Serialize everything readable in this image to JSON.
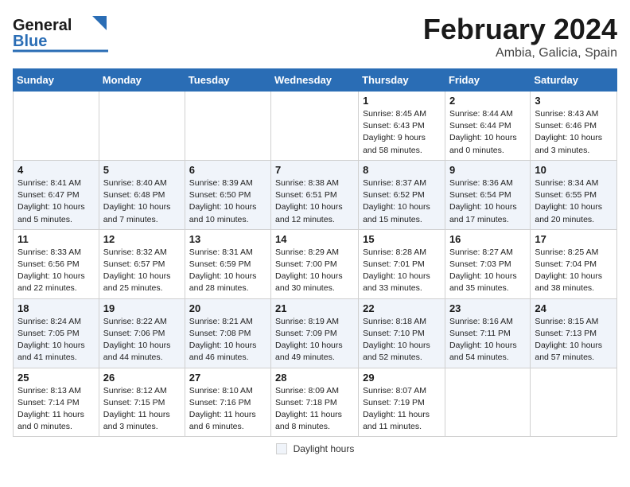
{
  "header": {
    "logo_general": "General",
    "logo_blue": "Blue",
    "month_title": "February 2024",
    "location": "Ambia, Galicia, Spain"
  },
  "calendar": {
    "days_of_week": [
      "Sunday",
      "Monday",
      "Tuesday",
      "Wednesday",
      "Thursday",
      "Friday",
      "Saturday"
    ],
    "weeks": [
      [
        {
          "day": "",
          "info": ""
        },
        {
          "day": "",
          "info": ""
        },
        {
          "day": "",
          "info": ""
        },
        {
          "day": "",
          "info": ""
        },
        {
          "day": "1",
          "info": "Sunrise: 8:45 AM\nSunset: 6:43 PM\nDaylight: 9 hours and 58 minutes."
        },
        {
          "day": "2",
          "info": "Sunrise: 8:44 AM\nSunset: 6:44 PM\nDaylight: 10 hours and 0 minutes."
        },
        {
          "day": "3",
          "info": "Sunrise: 8:43 AM\nSunset: 6:46 PM\nDaylight: 10 hours and 3 minutes."
        }
      ],
      [
        {
          "day": "4",
          "info": "Sunrise: 8:41 AM\nSunset: 6:47 PM\nDaylight: 10 hours and 5 minutes."
        },
        {
          "day": "5",
          "info": "Sunrise: 8:40 AM\nSunset: 6:48 PM\nDaylight: 10 hours and 7 minutes."
        },
        {
          "day": "6",
          "info": "Sunrise: 8:39 AM\nSunset: 6:50 PM\nDaylight: 10 hours and 10 minutes."
        },
        {
          "day": "7",
          "info": "Sunrise: 8:38 AM\nSunset: 6:51 PM\nDaylight: 10 hours and 12 minutes."
        },
        {
          "day": "8",
          "info": "Sunrise: 8:37 AM\nSunset: 6:52 PM\nDaylight: 10 hours and 15 minutes."
        },
        {
          "day": "9",
          "info": "Sunrise: 8:36 AM\nSunset: 6:54 PM\nDaylight: 10 hours and 17 minutes."
        },
        {
          "day": "10",
          "info": "Sunrise: 8:34 AM\nSunset: 6:55 PM\nDaylight: 10 hours and 20 minutes."
        }
      ],
      [
        {
          "day": "11",
          "info": "Sunrise: 8:33 AM\nSunset: 6:56 PM\nDaylight: 10 hours and 22 minutes."
        },
        {
          "day": "12",
          "info": "Sunrise: 8:32 AM\nSunset: 6:57 PM\nDaylight: 10 hours and 25 minutes."
        },
        {
          "day": "13",
          "info": "Sunrise: 8:31 AM\nSunset: 6:59 PM\nDaylight: 10 hours and 28 minutes."
        },
        {
          "day": "14",
          "info": "Sunrise: 8:29 AM\nSunset: 7:00 PM\nDaylight: 10 hours and 30 minutes."
        },
        {
          "day": "15",
          "info": "Sunrise: 8:28 AM\nSunset: 7:01 PM\nDaylight: 10 hours and 33 minutes."
        },
        {
          "day": "16",
          "info": "Sunrise: 8:27 AM\nSunset: 7:03 PM\nDaylight: 10 hours and 35 minutes."
        },
        {
          "day": "17",
          "info": "Sunrise: 8:25 AM\nSunset: 7:04 PM\nDaylight: 10 hours and 38 minutes."
        }
      ],
      [
        {
          "day": "18",
          "info": "Sunrise: 8:24 AM\nSunset: 7:05 PM\nDaylight: 10 hours and 41 minutes."
        },
        {
          "day": "19",
          "info": "Sunrise: 8:22 AM\nSunset: 7:06 PM\nDaylight: 10 hours and 44 minutes."
        },
        {
          "day": "20",
          "info": "Sunrise: 8:21 AM\nSunset: 7:08 PM\nDaylight: 10 hours and 46 minutes."
        },
        {
          "day": "21",
          "info": "Sunrise: 8:19 AM\nSunset: 7:09 PM\nDaylight: 10 hours and 49 minutes."
        },
        {
          "day": "22",
          "info": "Sunrise: 8:18 AM\nSunset: 7:10 PM\nDaylight: 10 hours and 52 minutes."
        },
        {
          "day": "23",
          "info": "Sunrise: 8:16 AM\nSunset: 7:11 PM\nDaylight: 10 hours and 54 minutes."
        },
        {
          "day": "24",
          "info": "Sunrise: 8:15 AM\nSunset: 7:13 PM\nDaylight: 10 hours and 57 minutes."
        }
      ],
      [
        {
          "day": "25",
          "info": "Sunrise: 8:13 AM\nSunset: 7:14 PM\nDaylight: 11 hours and 0 minutes."
        },
        {
          "day": "26",
          "info": "Sunrise: 8:12 AM\nSunset: 7:15 PM\nDaylight: 11 hours and 3 minutes."
        },
        {
          "day": "27",
          "info": "Sunrise: 8:10 AM\nSunset: 7:16 PM\nDaylight: 11 hours and 6 minutes."
        },
        {
          "day": "28",
          "info": "Sunrise: 8:09 AM\nSunset: 7:18 PM\nDaylight: 11 hours and 8 minutes."
        },
        {
          "day": "29",
          "info": "Sunrise: 8:07 AM\nSunset: 7:19 PM\nDaylight: 11 hours and 11 minutes."
        },
        {
          "day": "",
          "info": ""
        },
        {
          "day": "",
          "info": ""
        }
      ]
    ]
  },
  "footer": {
    "daylight_label": "Daylight hours"
  }
}
